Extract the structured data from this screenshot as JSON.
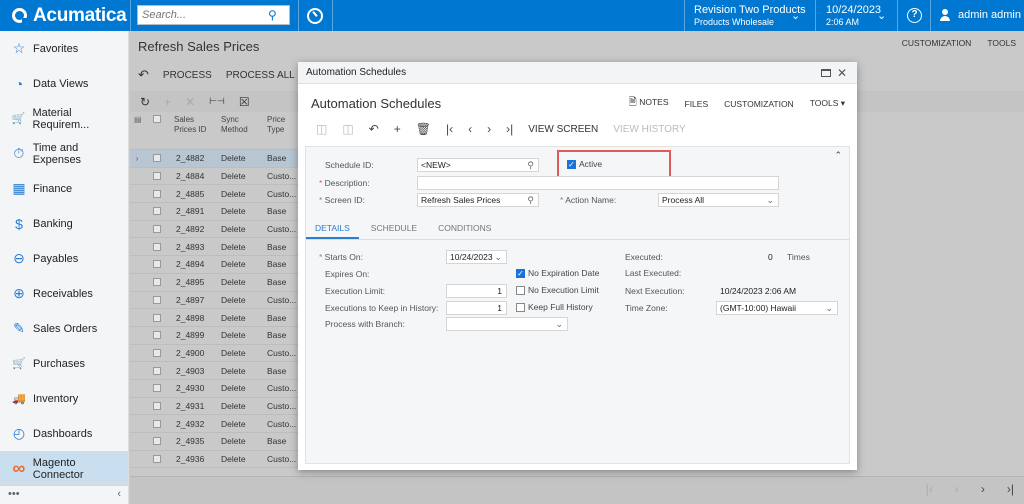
{
  "topbar": {
    "app_name": "Acumatica",
    "search_placeholder": "Search...",
    "branch_line1": "Revision Two Products",
    "branch_line2": "Products Wholesale",
    "date": "10/24/2023",
    "time": "2:06 AM",
    "help": "?",
    "user": "admin admin"
  },
  "sidebar": {
    "items": [
      {
        "label": "Favorites",
        "icon": "☆"
      },
      {
        "label": "Data Views",
        "icon": "◔"
      },
      {
        "label": "Material Requirem...",
        "icon": "🛒"
      },
      {
        "label": "Time and Expenses",
        "icon": "⏱"
      },
      {
        "label": "Finance",
        "icon": "▦"
      },
      {
        "label": "Banking",
        "icon": "$"
      },
      {
        "label": "Payables",
        "icon": "⊖"
      },
      {
        "label": "Receivables",
        "icon": "⊕"
      },
      {
        "label": "Sales Orders",
        "icon": "✎"
      },
      {
        "label": "Purchases",
        "icon": "🛒"
      },
      {
        "label": "Inventory",
        "icon": "🚚"
      },
      {
        "label": "Dashboards",
        "icon": "◴"
      },
      {
        "label": "Magento Connector",
        "icon": "∞"
      }
    ],
    "more": "•••",
    "collapse": "‹"
  },
  "main": {
    "title": "Refresh Sales Prices",
    "top_links": [
      "CUSTOMIZATION",
      "TOOLS"
    ],
    "toolbar": {
      "undo": "↶",
      "process": "PROCESS",
      "process_all": "PROCESS ALL"
    },
    "grid_toolbar": {
      "refresh": "↻",
      "add": "+",
      "delete": "✕",
      "fit": "⊢⊣",
      "excel": "☒"
    },
    "grid": {
      "headers": [
        "Sales Prices ID",
        "Sync Method",
        "Price Type"
      ],
      "rows": [
        [
          "2_4882",
          "Delete",
          "Base"
        ],
        [
          "2_4884",
          "Delete",
          "Custo..."
        ],
        [
          "2_4885",
          "Delete",
          "Custo..."
        ],
        [
          "2_4891",
          "Delete",
          "Base"
        ],
        [
          "2_4892",
          "Delete",
          "Custo..."
        ],
        [
          "2_4893",
          "Delete",
          "Base"
        ],
        [
          "2_4894",
          "Delete",
          "Base"
        ],
        [
          "2_4895",
          "Delete",
          "Base"
        ],
        [
          "2_4897",
          "Delete",
          "Custo..."
        ],
        [
          "2_4898",
          "Delete",
          "Base"
        ],
        [
          "2_4899",
          "Delete",
          "Base"
        ],
        [
          "2_4900",
          "Delete",
          "Custo..."
        ],
        [
          "2_4903",
          "Delete",
          "Base"
        ],
        [
          "2_4930",
          "Delete",
          "Custo..."
        ],
        [
          "2_4931",
          "Delete",
          "Custo..."
        ],
        [
          "2_4932",
          "Delete",
          "Custo..."
        ],
        [
          "2_4935",
          "Delete",
          "Base"
        ],
        [
          "2_4936",
          "Delete",
          "Custo..."
        ]
      ]
    },
    "pager": {
      "first": "|‹",
      "prev": "‹",
      "next": "›",
      "last": "›|"
    }
  },
  "modal": {
    "window_title": "Automation Schedules",
    "title": "Automation Schedules",
    "links": {
      "notes": "NOTES",
      "files": "FILES",
      "customization": "CUSTOMIZATION",
      "tools": "TOOLS ▾"
    },
    "toolbar": {
      "view_screen": "VIEW SCREEN",
      "view_history": "VIEW HISTORY"
    },
    "form": {
      "schedule_id_label": "Schedule ID:",
      "schedule_id": "<NEW>",
      "active_label": "Active",
      "active": true,
      "description_label": "Description:",
      "description": "",
      "screen_id_label": "Screen ID:",
      "screen_id": "Refresh  Sales Prices",
      "action_name_label": "Action Name:",
      "action_name": "Process All"
    },
    "tabs": [
      "DETAILS",
      "SCHEDULE",
      "CONDITIONS"
    ],
    "details": {
      "starts_on_label": "Starts On:",
      "starts_on": "10/24/2023",
      "expires_on_label": "Expires On:",
      "no_expiration_label": "No Expiration Date",
      "no_expiration": true,
      "execution_limit_label": "Execution Limit:",
      "execution_limit": "1",
      "no_execution_limit_label": "No Execution Limit",
      "no_execution_limit": false,
      "keep_history_label": "Executions to Keep in History:",
      "keep_history": "1",
      "keep_full_history_label": "Keep Full History",
      "keep_full_history": false,
      "branch_label": "Process with Branch:",
      "branch": "",
      "executed_label": "Executed:",
      "executed": "0",
      "times_label": "Times",
      "last_executed_label": "Last Executed:",
      "last_executed": "",
      "next_execution_label": "Next Execution:",
      "next_execution": "10/24/2023 2:06 AM",
      "time_zone_label": "Time Zone:",
      "time_zone": "(GMT-10:00) Hawaii"
    }
  }
}
